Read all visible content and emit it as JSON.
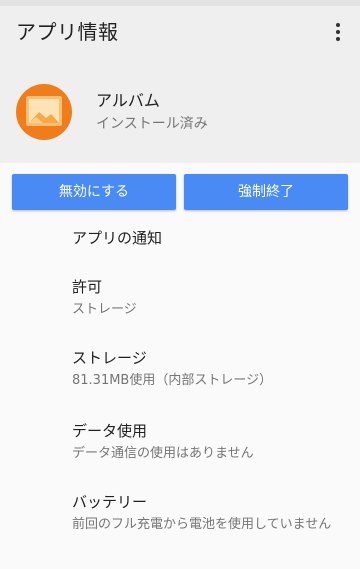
{
  "header": {
    "title": "アプリ情報",
    "menu_icon": "more-vert-icon"
  },
  "app": {
    "name": "アルバム",
    "status": "インストール済み",
    "icon": "photo-album-icon",
    "icon_color": "#f07d1a"
  },
  "buttons": {
    "disable_label": "無効にする",
    "force_stop_label": "強制終了",
    "color": "#4a8af4"
  },
  "settings": {
    "notifications": {
      "title": "アプリの通知"
    },
    "permissions": {
      "title": "許可",
      "summary": "ストレージ"
    },
    "storage": {
      "title": "ストレージ",
      "summary": "81.31MB使用（内部ストレージ）"
    },
    "data_usage": {
      "title": "データ使用",
      "summary": "データ通信の使用はありません"
    },
    "battery": {
      "title": "バッテリー",
      "summary": "前回のフル充電から電池を使用していません"
    }
  }
}
